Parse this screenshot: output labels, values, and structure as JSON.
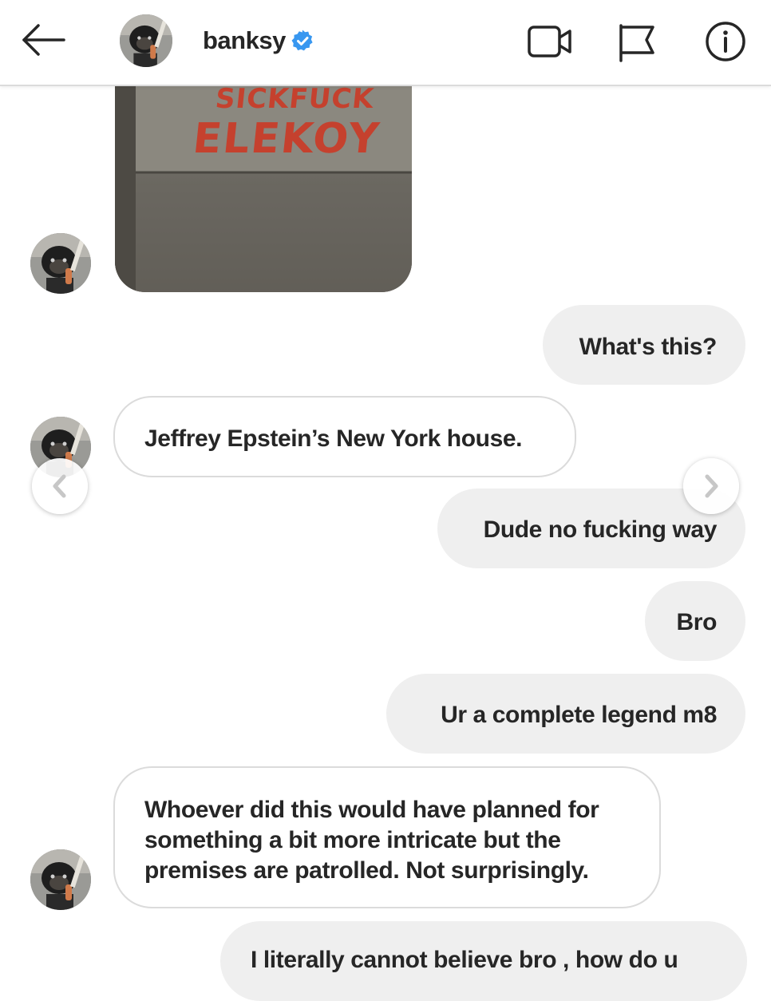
{
  "header": {
    "username": "banksy",
    "icons": [
      "back-arrow-icon",
      "verified-badge-icon",
      "video-call-icon",
      "flag-icon",
      "info-icon"
    ]
  },
  "shared_image": {
    "graffiti_line1": "SICKFUCK",
    "graffiti_line2": "ELEKOY"
  },
  "messages": [
    {
      "from": "me",
      "text": "What's this?"
    },
    {
      "from": "banksy",
      "text": "Jeffrey Epstein’s New York house."
    },
    {
      "from": "me",
      "text": "Dude no fucking way"
    },
    {
      "from": "me",
      "text": "Bro"
    },
    {
      "from": "me",
      "text": "Ur a complete legend m8"
    },
    {
      "from": "banksy",
      "text": "Whoever did this would have planned for something a bit more intricate but the premises are patrolled. Not surprisingly."
    },
    {
      "from": "me",
      "text": "I literally cannot believe bro , how do u"
    }
  ],
  "colors": {
    "outgoing_bubble": "#efefef",
    "incoming_border": "#dbdbdb",
    "verified_blue": "#3897f0",
    "text": "#262626",
    "graffiti_red": "#c5412e"
  }
}
